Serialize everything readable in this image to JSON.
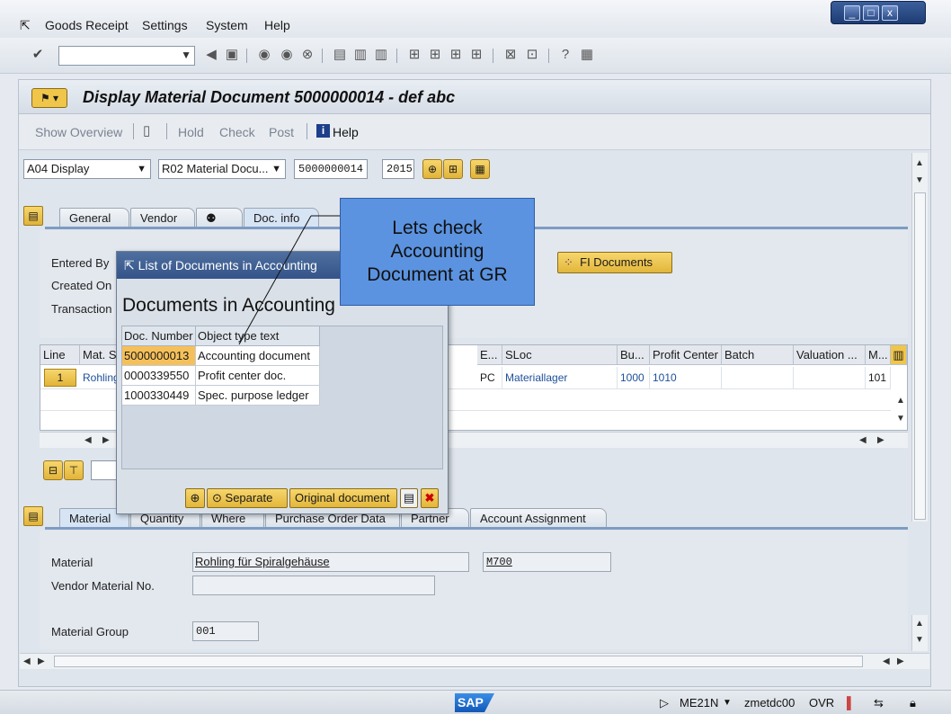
{
  "menu": {
    "items": [
      "Goods Receipt",
      "Settings",
      "System",
      "Help"
    ]
  },
  "window_controls": {
    "minimize": "_",
    "restore": "□",
    "close": "x"
  },
  "toolbar": {
    "command_value": ""
  },
  "title": {
    "text": "Display Material Document 5000000014 - def abc"
  },
  "appbar": {
    "show_overview": "Show Overview",
    "hold": "Hold",
    "check": "Check",
    "post": "Post",
    "help": "Help"
  },
  "selectors": {
    "action": "A04 Display",
    "reference": "R02 Material Docu...",
    "doc_number": "5000000014",
    "year": "2015"
  },
  "header_tabs": [
    "General",
    "Vendor",
    "Doc. info"
  ],
  "doc_info": {
    "entered_by_label": "Entered By",
    "created_on_label": "Created On",
    "transaction_label": "Transaction",
    "fi_documents_btn": "FI Documents"
  },
  "items_grid": {
    "headers": [
      "Line",
      "Mat. S",
      "E...",
      "SLoc",
      "Bu...",
      "Profit Center",
      "Batch",
      "Valuation ...",
      "M..."
    ],
    "row": {
      "line": "1",
      "mat_short": "Rohling",
      "e": "PC",
      "sloc": "Materiallager",
      "bu": "1000",
      "profit_center": "1010",
      "batch": "",
      "valuation": "",
      "movement": "101"
    }
  },
  "item_tabs": [
    "Material",
    "Quantity",
    "Where",
    "Purchase Order Data",
    "Partner",
    "Account Assignment"
  ],
  "material_detail": {
    "material_label": "Material",
    "material_value": "Rohling für Spiralgehäuse",
    "material_code": "M700",
    "vendor_material_label": "Vendor Material No.",
    "vendor_material_value": "",
    "material_group_label": "Material Group",
    "material_group_value": "001"
  },
  "dialog": {
    "title": "List of Documents in Accounting",
    "heading": "Documents in Accounting",
    "col_doc_number": "Doc. Number",
    "col_object_type": "Object type text",
    "rows": [
      {
        "doc": "5000000013",
        "type": "Accounting document"
      },
      {
        "doc": "0000339550",
        "type": "Profit center doc."
      },
      {
        "doc": "1000330449",
        "type": "Spec. purpose ledger"
      }
    ],
    "separate_btn": "Separate",
    "original_btn": "Original document"
  },
  "callout": {
    "line1": "Lets check",
    "line2": "Accounting",
    "line3": "Document at GR"
  },
  "status": {
    "logo": "SAP",
    "transaction": "ME21N",
    "server": "zmetdc00",
    "mode": "OVR"
  },
  "colors": {
    "accent_blue": "#34548a",
    "callout_blue": "#5b93e0",
    "button_yellow": "#f0c64a",
    "selected_row": "#f5c05a"
  }
}
